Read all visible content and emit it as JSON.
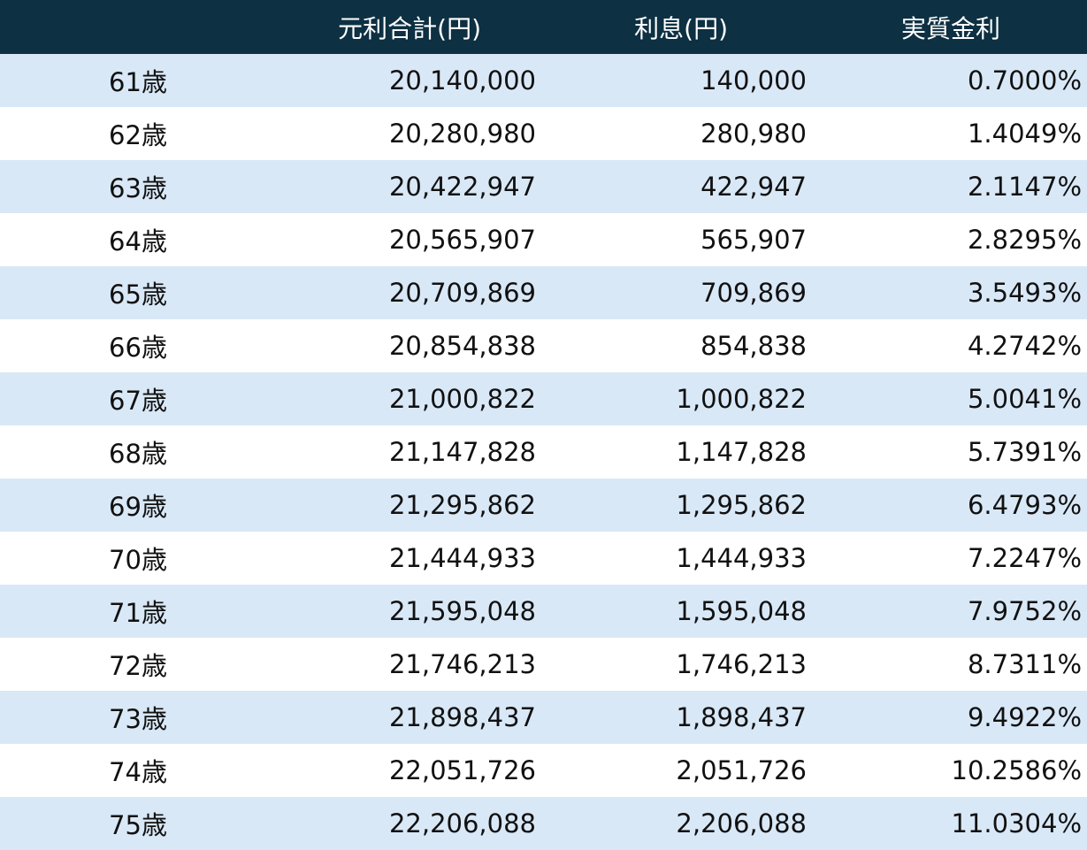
{
  "headers": {
    "age": "",
    "total": "元利合計(円)",
    "interest": "利息(円)",
    "rate": "実質金利"
  },
  "rows": [
    {
      "age": "61歳",
      "total": "20,140,000",
      "interest": "140,000",
      "rate": "0.7000%"
    },
    {
      "age": "62歳",
      "total": "20,280,980",
      "interest": "280,980",
      "rate": "1.4049%"
    },
    {
      "age": "63歳",
      "total": "20,422,947",
      "interest": "422,947",
      "rate": "2.1147%"
    },
    {
      "age": "64歳",
      "total": "20,565,907",
      "interest": "565,907",
      "rate": "2.8295%"
    },
    {
      "age": "65歳",
      "total": "20,709,869",
      "interest": "709,869",
      "rate": "3.5493%"
    },
    {
      "age": "66歳",
      "total": "20,854,838",
      "interest": "854,838",
      "rate": "4.2742%"
    },
    {
      "age": "67歳",
      "total": "21,000,822",
      "interest": "1,000,822",
      "rate": "5.0041%"
    },
    {
      "age": "68歳",
      "total": "21,147,828",
      "interest": "1,147,828",
      "rate": "5.7391%"
    },
    {
      "age": "69歳",
      "total": "21,295,862",
      "interest": "1,295,862",
      "rate": "6.4793%"
    },
    {
      "age": "70歳",
      "total": "21,444,933",
      "interest": "1,444,933",
      "rate": "7.2247%"
    },
    {
      "age": "71歳",
      "total": "21,595,048",
      "interest": "1,595,048",
      "rate": "7.9752%"
    },
    {
      "age": "72歳",
      "total": "21,746,213",
      "interest": "1,746,213",
      "rate": "8.7311%"
    },
    {
      "age": "73歳",
      "total": "21,898,437",
      "interest": "1,898,437",
      "rate": "9.4922%"
    },
    {
      "age": "74歳",
      "total": "22,051,726",
      "interest": "2,051,726",
      "rate": "10.2586%"
    },
    {
      "age": "75歳",
      "total": "22,206,088",
      "interest": "2,206,088",
      "rate": "11.0304%"
    }
  ],
  "colors": {
    "header_bg": "#0d3042",
    "header_text": "#ffffff",
    "band_bg": "#d9e8f7",
    "plain_bg": "#ffffff"
  }
}
